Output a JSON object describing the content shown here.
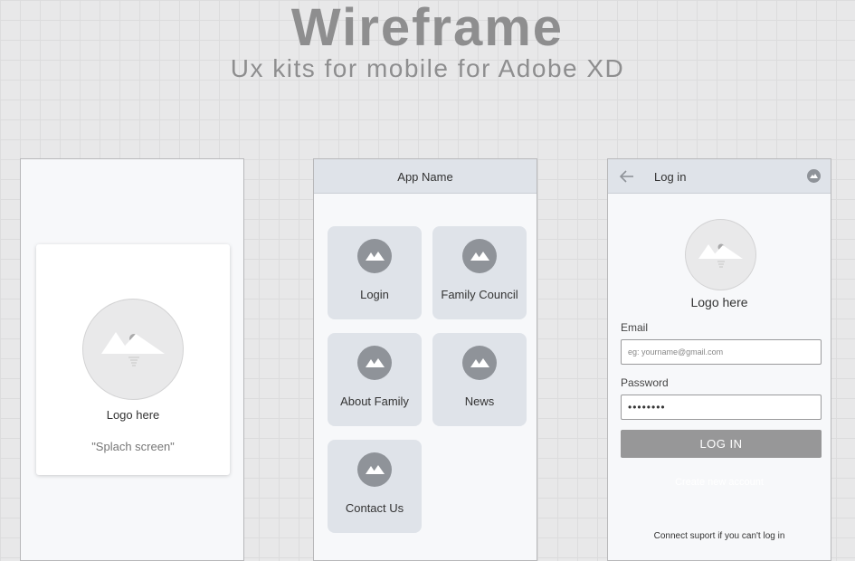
{
  "header": {
    "title": "Wireframe",
    "subtitle": "Ux kits for mobile for Adobe XD"
  },
  "splash": {
    "logo_text": "Logo here",
    "caption": "\"Splach screen\"",
    "icon": "image-placeholder-icon"
  },
  "home": {
    "app_name": "App Name",
    "tiles": [
      {
        "label": "Login",
        "icon": "image-icon"
      },
      {
        "label": "Family Council",
        "icon": "image-icon"
      },
      {
        "label": "About Family",
        "icon": "image-icon"
      },
      {
        "label": "News",
        "icon": "image-icon"
      },
      {
        "label": "Contact Us",
        "icon": "image-icon"
      }
    ]
  },
  "login": {
    "title": "Log in",
    "logo_text": "Logo here",
    "email_label": "Email",
    "email_placeholder": "eg: yourname@gmail.com",
    "password_label": "Password",
    "password_value": "••••••••",
    "button_label": "LOG IN",
    "create_account": "Create new account",
    "support_text": "Connect suport if you can't log in",
    "icons": {
      "back": "arrow-left-icon",
      "avatar": "avatar-icon"
    }
  },
  "colors": {
    "background": "#e8e8e9",
    "title": "#8e8e8f",
    "appbar": "#dfe3e9",
    "tile": "#dfe3e9",
    "tile_icon": "#8f9399",
    "button": "#979798"
  }
}
